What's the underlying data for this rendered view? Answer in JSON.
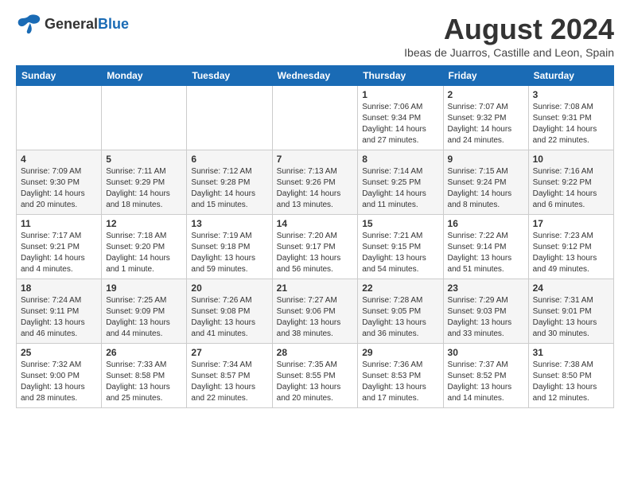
{
  "header": {
    "logo_line1": "General",
    "logo_line2": "Blue",
    "month_title": "August 2024",
    "subtitle": "Ibeas de Juarros, Castille and Leon, Spain"
  },
  "weekdays": [
    "Sunday",
    "Monday",
    "Tuesday",
    "Wednesday",
    "Thursday",
    "Friday",
    "Saturday"
  ],
  "weeks": [
    [
      {
        "day": "",
        "info": ""
      },
      {
        "day": "",
        "info": ""
      },
      {
        "day": "",
        "info": ""
      },
      {
        "day": "",
        "info": ""
      },
      {
        "day": "1",
        "info": "Sunrise: 7:06 AM\nSunset: 9:34 PM\nDaylight: 14 hours and 27 minutes."
      },
      {
        "day": "2",
        "info": "Sunrise: 7:07 AM\nSunset: 9:32 PM\nDaylight: 14 hours and 24 minutes."
      },
      {
        "day": "3",
        "info": "Sunrise: 7:08 AM\nSunset: 9:31 PM\nDaylight: 14 hours and 22 minutes."
      }
    ],
    [
      {
        "day": "4",
        "info": "Sunrise: 7:09 AM\nSunset: 9:30 PM\nDaylight: 14 hours and 20 minutes."
      },
      {
        "day": "5",
        "info": "Sunrise: 7:11 AM\nSunset: 9:29 PM\nDaylight: 14 hours and 18 minutes."
      },
      {
        "day": "6",
        "info": "Sunrise: 7:12 AM\nSunset: 9:28 PM\nDaylight: 14 hours and 15 minutes."
      },
      {
        "day": "7",
        "info": "Sunrise: 7:13 AM\nSunset: 9:26 PM\nDaylight: 14 hours and 13 minutes."
      },
      {
        "day": "8",
        "info": "Sunrise: 7:14 AM\nSunset: 9:25 PM\nDaylight: 14 hours and 11 minutes."
      },
      {
        "day": "9",
        "info": "Sunrise: 7:15 AM\nSunset: 9:24 PM\nDaylight: 14 hours and 8 minutes."
      },
      {
        "day": "10",
        "info": "Sunrise: 7:16 AM\nSunset: 9:22 PM\nDaylight: 14 hours and 6 minutes."
      }
    ],
    [
      {
        "day": "11",
        "info": "Sunrise: 7:17 AM\nSunset: 9:21 PM\nDaylight: 14 hours and 4 minutes."
      },
      {
        "day": "12",
        "info": "Sunrise: 7:18 AM\nSunset: 9:20 PM\nDaylight: 14 hours and 1 minute."
      },
      {
        "day": "13",
        "info": "Sunrise: 7:19 AM\nSunset: 9:18 PM\nDaylight: 13 hours and 59 minutes."
      },
      {
        "day": "14",
        "info": "Sunrise: 7:20 AM\nSunset: 9:17 PM\nDaylight: 13 hours and 56 minutes."
      },
      {
        "day": "15",
        "info": "Sunrise: 7:21 AM\nSunset: 9:15 PM\nDaylight: 13 hours and 54 minutes."
      },
      {
        "day": "16",
        "info": "Sunrise: 7:22 AM\nSunset: 9:14 PM\nDaylight: 13 hours and 51 minutes."
      },
      {
        "day": "17",
        "info": "Sunrise: 7:23 AM\nSunset: 9:12 PM\nDaylight: 13 hours and 49 minutes."
      }
    ],
    [
      {
        "day": "18",
        "info": "Sunrise: 7:24 AM\nSunset: 9:11 PM\nDaylight: 13 hours and 46 minutes."
      },
      {
        "day": "19",
        "info": "Sunrise: 7:25 AM\nSunset: 9:09 PM\nDaylight: 13 hours and 44 minutes."
      },
      {
        "day": "20",
        "info": "Sunrise: 7:26 AM\nSunset: 9:08 PM\nDaylight: 13 hours and 41 minutes."
      },
      {
        "day": "21",
        "info": "Sunrise: 7:27 AM\nSunset: 9:06 PM\nDaylight: 13 hours and 38 minutes."
      },
      {
        "day": "22",
        "info": "Sunrise: 7:28 AM\nSunset: 9:05 PM\nDaylight: 13 hours and 36 minutes."
      },
      {
        "day": "23",
        "info": "Sunrise: 7:29 AM\nSunset: 9:03 PM\nDaylight: 13 hours and 33 minutes."
      },
      {
        "day": "24",
        "info": "Sunrise: 7:31 AM\nSunset: 9:01 PM\nDaylight: 13 hours and 30 minutes."
      }
    ],
    [
      {
        "day": "25",
        "info": "Sunrise: 7:32 AM\nSunset: 9:00 PM\nDaylight: 13 hours and 28 minutes."
      },
      {
        "day": "26",
        "info": "Sunrise: 7:33 AM\nSunset: 8:58 PM\nDaylight: 13 hours and 25 minutes."
      },
      {
        "day": "27",
        "info": "Sunrise: 7:34 AM\nSunset: 8:57 PM\nDaylight: 13 hours and 22 minutes."
      },
      {
        "day": "28",
        "info": "Sunrise: 7:35 AM\nSunset: 8:55 PM\nDaylight: 13 hours and 20 minutes."
      },
      {
        "day": "29",
        "info": "Sunrise: 7:36 AM\nSunset: 8:53 PM\nDaylight: 13 hours and 17 minutes."
      },
      {
        "day": "30",
        "info": "Sunrise: 7:37 AM\nSunset: 8:52 PM\nDaylight: 13 hours and 14 minutes."
      },
      {
        "day": "31",
        "info": "Sunrise: 7:38 AM\nSunset: 8:50 PM\nDaylight: 13 hours and 12 minutes."
      }
    ]
  ]
}
